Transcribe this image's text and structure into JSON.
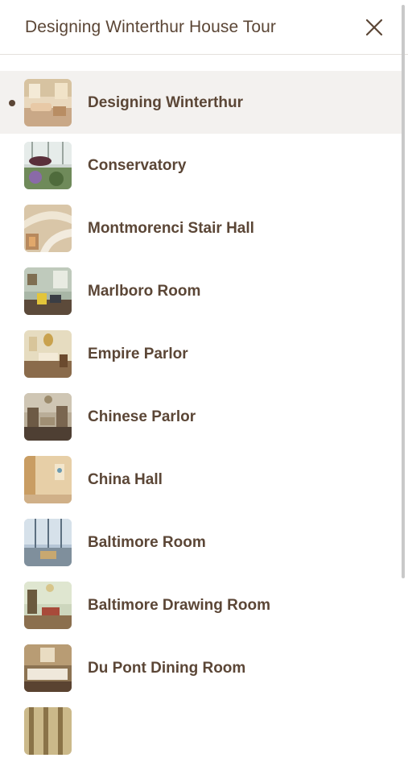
{
  "header": {
    "title": "Designing Winterthur House Tour"
  },
  "close": {
    "icon": "close-icon"
  },
  "tour": {
    "current_index": 0,
    "stops": [
      {
        "label": "Designing Winterthur",
        "active": true
      },
      {
        "label": "Conservatory",
        "active": false
      },
      {
        "label": "Montmorenci Stair Hall",
        "active": false
      },
      {
        "label": "Marlboro Room",
        "active": false
      },
      {
        "label": "Empire Parlor",
        "active": false
      },
      {
        "label": "Chinese Parlor",
        "active": false
      },
      {
        "label": "China Hall",
        "active": false
      },
      {
        "label": "Baltimore Room",
        "active": false
      },
      {
        "label": "Baltimore Drawing Room",
        "active": false
      },
      {
        "label": "Du Pont Dining Room",
        "active": false
      },
      {
        "label": "",
        "active": false
      }
    ]
  },
  "colors": {
    "text": "#5b4636",
    "active_bg": "#f3f1ef",
    "divider": "#e4e0dc"
  }
}
